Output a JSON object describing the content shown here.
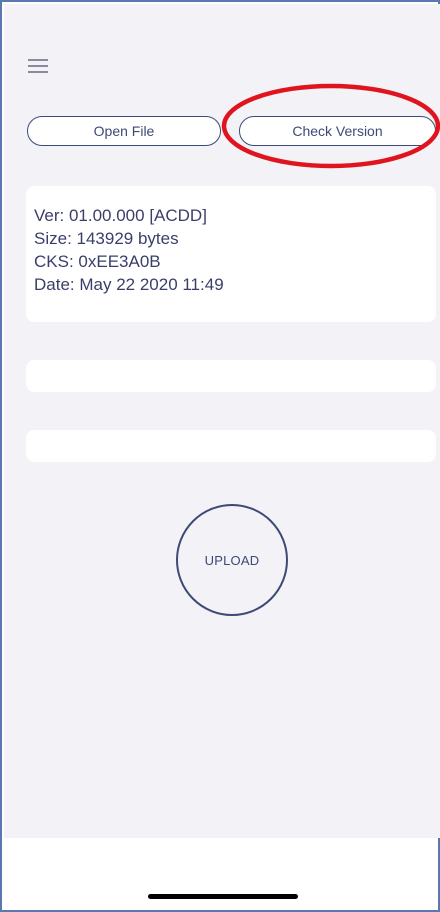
{
  "toolbar": {
    "menu_icon": "hamburger-menu-icon",
    "open_file_label": "Open File",
    "check_version_label": "Check Version"
  },
  "file_info": {
    "version": "Ver: 01.00.000 [ACDD]",
    "size": "Size: 143929 bytes",
    "checksum": "CKS: 0xEE3A0B",
    "date": "Date: May 22 2020 11:49"
  },
  "progress": {
    "bar1_text": "",
    "bar2_text": ""
  },
  "upload": {
    "label": "UPLOAD"
  },
  "colors": {
    "accent": "#3d4a75",
    "background": "#f2f2f7",
    "card": "#ffffff",
    "highlight": "#e0141e"
  }
}
